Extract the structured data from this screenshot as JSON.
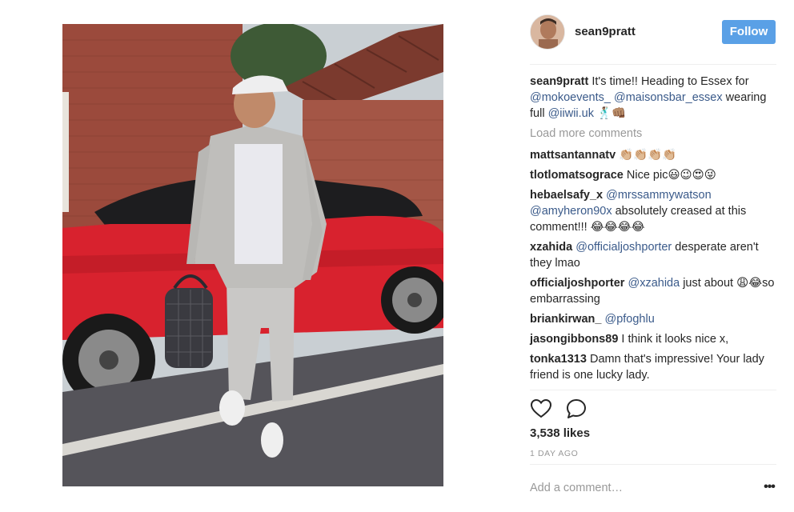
{
  "post": {
    "author": "sean9pratt",
    "follow_label": "Follow",
    "caption": {
      "user": "sean9pratt",
      "text1": " It's time!! Heading to Essex for ",
      "mention1": "@mokoevents_",
      "text2": " ",
      "mention2": "@maisonsbar_essex",
      "text3": " wearing full ",
      "mention3": "@iiwii.uk",
      "emoji": "🕺🏽👊🏽"
    },
    "load_more": "Load more comments",
    "comments": [
      {
        "user": "mattsantannatv",
        "text": " 👏🏼👏🏼👏🏼👏🏼"
      },
      {
        "user": "tlotlomatsograce",
        "text": " Nice pic😃😉😍😜"
      },
      {
        "user": "hebaelsafy_x",
        "mention": "@mrssammywatson",
        "mention2": "@amyheron90x",
        "text": " absolutely creased at this comment!!! 😂😂😂😂"
      },
      {
        "user": "xzahida",
        "mention": "@officialjoshporter",
        "text": " desperate aren't they lmao"
      },
      {
        "user": "officialjoshporter",
        "mention": "@xzahida",
        "text": " just about 😩😂so embarrassing"
      },
      {
        "user": "briankirwan_",
        "mention": "@pfoghlu",
        "text": ""
      },
      {
        "user": "jasongibbons89",
        "text": " I think it looks nice x,"
      },
      {
        "user": "tonka1313",
        "text": " Damn that's impressive! Your lady friend is one lucky lady."
      }
    ],
    "likes": "3,538 likes",
    "time": "1 DAY AGO",
    "add_comment_placeholder": "Add a comment…",
    "more_label": "•••"
  },
  "colors": {
    "follow_bg": "#5aa0e6",
    "mention": "#3a5a8a",
    "muted": "#999999"
  },
  "icons": [
    "heart-icon",
    "comment-icon",
    "more-options-icon"
  ]
}
